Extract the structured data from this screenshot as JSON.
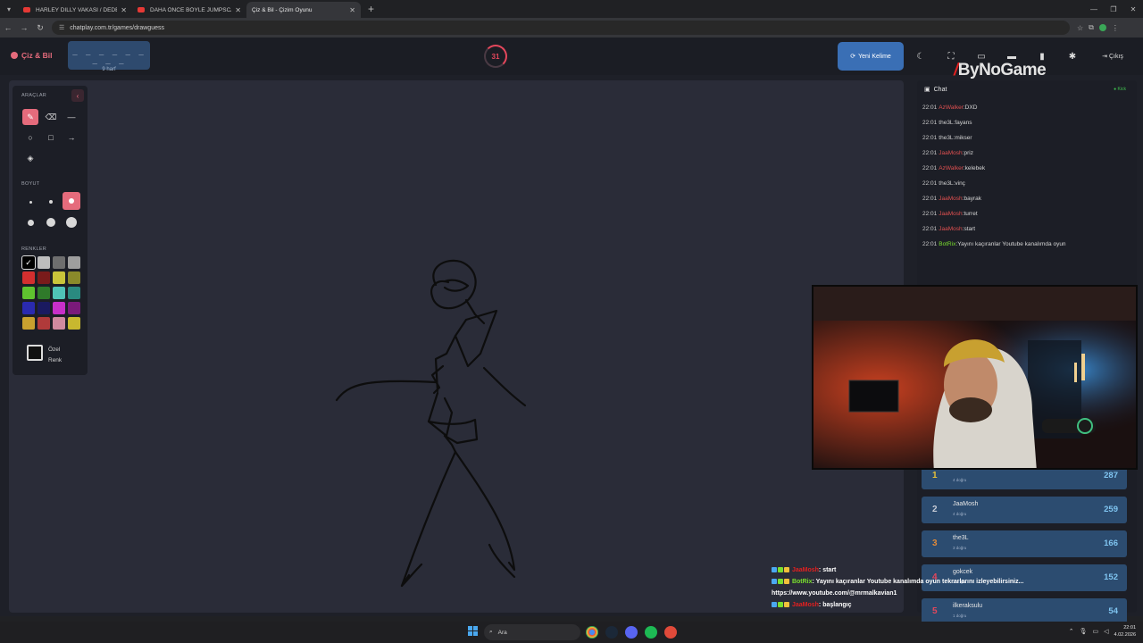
{
  "browser": {
    "tabs": [
      {
        "title": "HARLEY DILLY VAKASI / DEDEK",
        "kind": "youtube"
      },
      {
        "title": "DAHA ÖNCE BÖYLE JUMPSCAR",
        "kind": "youtube"
      },
      {
        "title": "Çiz & Bil - Çizim Oyunu",
        "kind": "site"
      }
    ],
    "url": "chatplay.com.tr/games/drawguess"
  },
  "header": {
    "brand": "Çiz & Bil",
    "word_hint": "_ _ _ _ _ _ _ _ _",
    "letter_count": "9 harf",
    "timer": "31",
    "new_word_label": "Yeni Kelime",
    "exit_label": "Çıkış",
    "icons": [
      "moon-icon",
      "fullscreen-icon",
      "keyboard-icon",
      "list-icon",
      "trash-icon",
      "gear-icon"
    ]
  },
  "watermark": {
    "text": "ByNoGame"
  },
  "tools": {
    "title": "ARAÇLAR",
    "size_title": "BOYUT",
    "colors_title": "RENKLER",
    "custom_color": [
      "Özel",
      "Renk"
    ],
    "colors": [
      "#000000",
      "#bdbdbd",
      "#6e6e6e",
      "#9e9e9e",
      "#d32f2f",
      "#7a1b1b",
      "#c8c43a",
      "#8a8a2a",
      "#5fc32f",
      "#2f7a2a",
      "#4fc3b7",
      "#2a8a80",
      "#2a2ab0",
      "#1a1a60",
      "#c82fc8",
      "#7a1a7a",
      "#c8a02f",
      "#b03a3a",
      "#d08aa0",
      "#c8b82f"
    ]
  },
  "chat": {
    "title": "Chat",
    "platform": "Kick",
    "messages": [
      {
        "time": "22:01",
        "user": "AzWalker",
        "text": "DXD",
        "color": "#e05050"
      },
      {
        "time": "22:01",
        "user": "the3L",
        "text": "fayans",
        "color": "#d0d0d0"
      },
      {
        "time": "22:01",
        "user": "the3L",
        "text": "mikser",
        "color": "#d0d0d0"
      },
      {
        "time": "22:01",
        "user": "JaaMosh",
        "text": "priz",
        "color": "#e05050"
      },
      {
        "time": "22:01",
        "user": "AzWalker",
        "text": "kelebek",
        "color": "#e05050"
      },
      {
        "time": "22:01",
        "user": "the3L",
        "text": "vinç",
        "color": "#d0d0d0"
      },
      {
        "time": "22:01",
        "user": "JaaMosh",
        "text": "bayrak",
        "color": "#e05050"
      },
      {
        "time": "22:01",
        "user": "JaaMosh",
        "text": "turret",
        "color": "#e05050"
      },
      {
        "time": "22:01",
        "user": "JaaMosh",
        "text": "start",
        "color": "#e05050"
      },
      {
        "time": "22:01",
        "user": "BotRix",
        "text": "Yayını kaçıranlar Youtube kanalımda oyun",
        "color": "#7adf2e"
      }
    ]
  },
  "leaderboard": [
    {
      "rank": "1",
      "name": "",
      "sub": "4 doğru",
      "score": "287",
      "color": "#e8c23a"
    },
    {
      "rank": "2",
      "name": "JaaMosh",
      "sub": "4 doğru",
      "score": "259",
      "color": "#c8ccd6"
    },
    {
      "rank": "3",
      "name": "the3L",
      "sub": "3 doğru",
      "score": "166",
      "color": "#e08a3a"
    },
    {
      "rank": "4",
      "name": "gokcek",
      "sub": "2 doğru",
      "score": "152",
      "color": "#e5475c"
    },
    {
      "rank": "5",
      "name": "ilkeraksulu",
      "sub": "1 doğru",
      "score": "54",
      "color": "#e5475c"
    }
  ],
  "overlay": {
    "lines": [
      {
        "user": "JaaMosh",
        "text": ": start",
        "user_color": "red"
      },
      {
        "user": "BotRix",
        "text": ": Yayını kaçıranlar Youtube kanalımda oyun tekrarlarını izleyebilirsiniz...",
        "user_color": "grn"
      },
      {
        "user": "",
        "text": "https://www.youtube.com/@mrmalkavian1",
        "user_color": "grn"
      },
      {
        "user": "JaaMosh",
        "text": ": başlangıç",
        "user_color": "red"
      }
    ]
  },
  "taskbar": {
    "search": "Ara",
    "time": "22:01",
    "date": "4.02.2026"
  }
}
